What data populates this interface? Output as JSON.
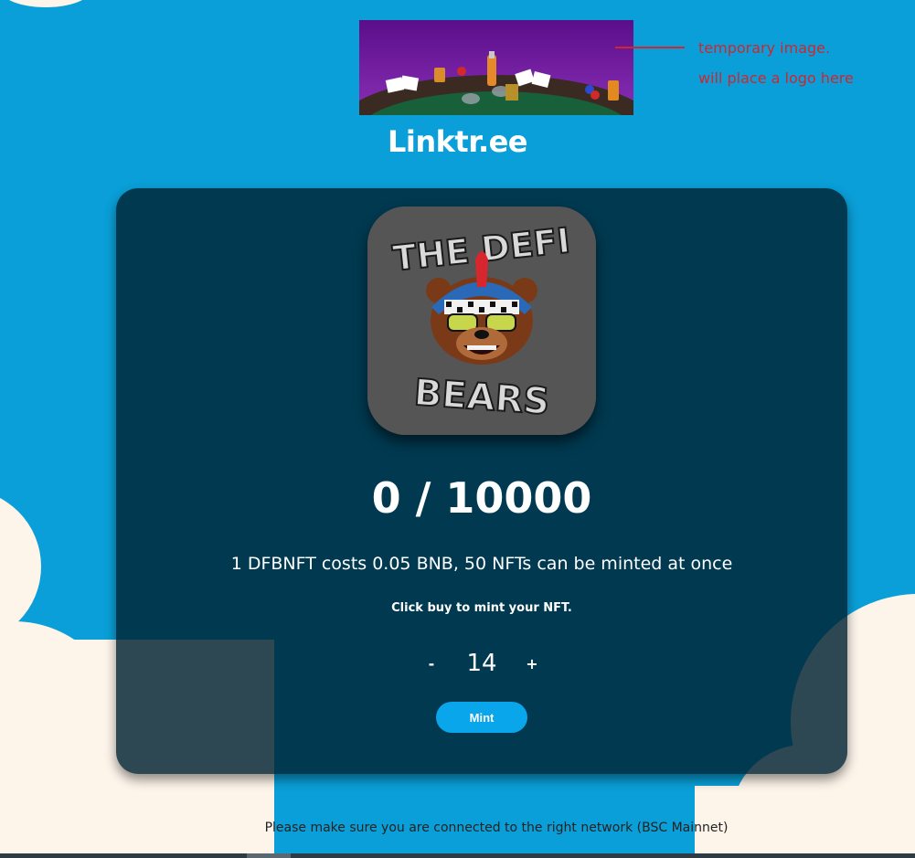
{
  "header": {
    "banner_note_lines": [
      "temporary image.",
      "will place a logo here"
    ],
    "site_title": "Linktr.ee"
  },
  "mint_card": {
    "collection_name_top": "THE DEFI",
    "collection_name_bottom": "BEARS",
    "minted_count": "0 / 10000",
    "price_text": "1 DFBNFT costs 0.05 BNB, 50 NFTs can be minted at once",
    "instruction": "Click buy to mint your NFT.",
    "decrement_label": "-",
    "quantity": "14",
    "increment_label": "+",
    "mint_label": "Mint"
  },
  "footer": {
    "network_note": "Please make sure you are connected to the right network (BSC Mainnet)"
  },
  "colors": {
    "background": "#0a9fd8",
    "cloud": "#fdf4ea",
    "card": "#002232",
    "mint_button": "#0aa6ec",
    "note_text": "#d0262e",
    "logo_tile": "#555555"
  }
}
